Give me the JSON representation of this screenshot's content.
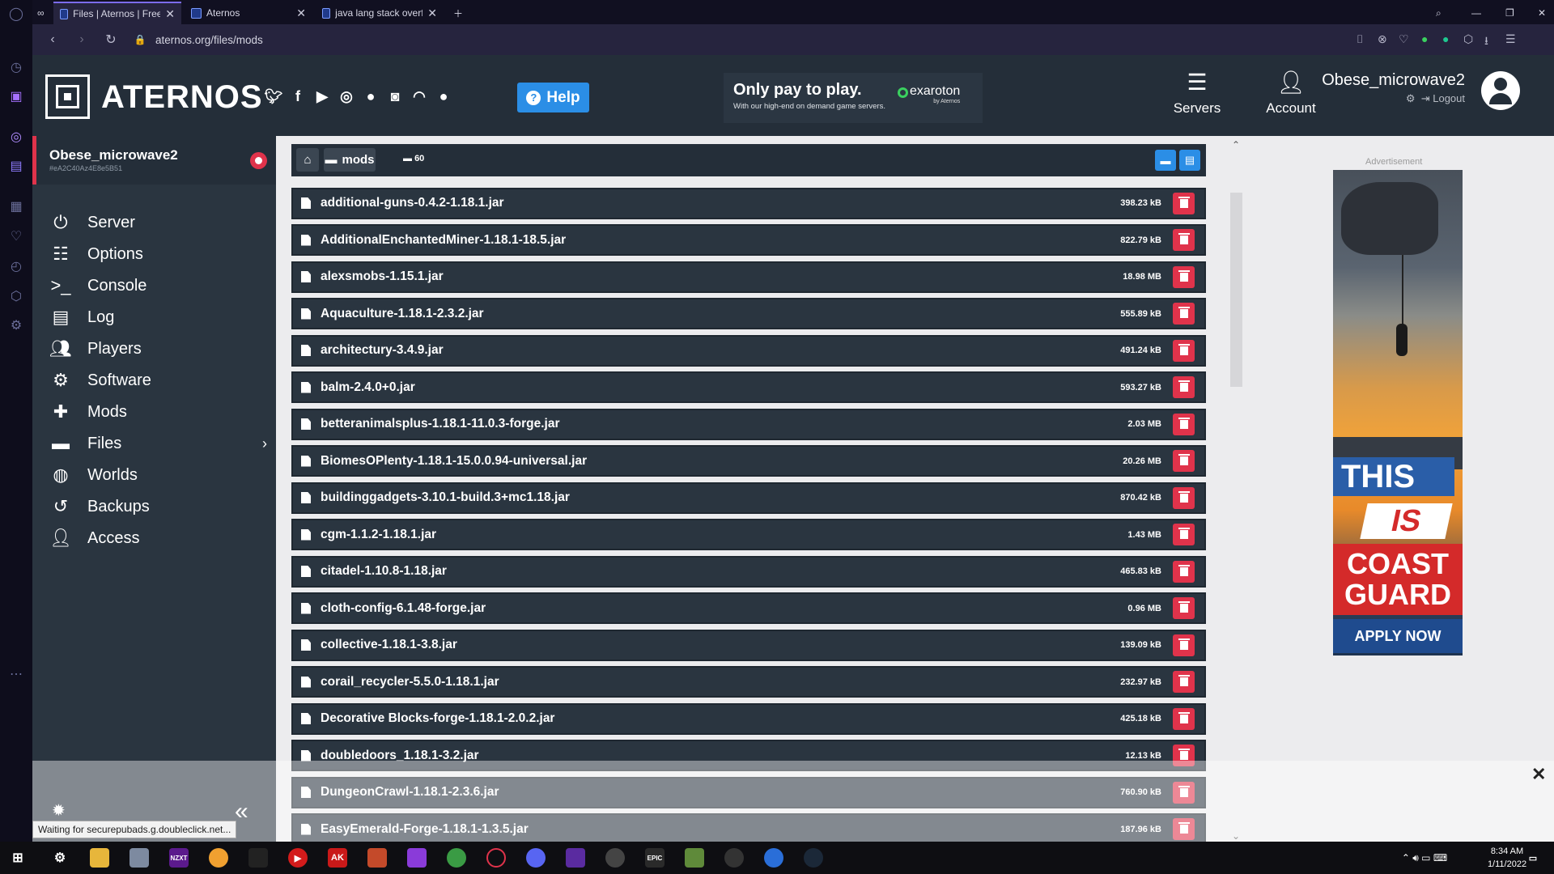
{
  "browser": {
    "tabs": [
      {
        "title": "Files | Aternos | Free Minec",
        "active": true
      },
      {
        "title": "Aternos",
        "active": false
      },
      {
        "title": "java lang stack overflow err",
        "active": false
      }
    ],
    "url": "aternos.org/files/mods",
    "status_text": "Waiting for securepubads.g.doubleclick.net..."
  },
  "header": {
    "logo": "ATERNOS",
    "help_label": "Help",
    "ad": {
      "headline": "Only pay to play.",
      "subline": "With our high-end on demand game servers.",
      "brand": "exaroton",
      "brand_sub": "by Aternos"
    },
    "nav": [
      {
        "label": "Servers",
        "icon": "servers-icon"
      },
      {
        "label": "Account",
        "icon": "account-icon"
      }
    ],
    "user": {
      "name": "Obese_microwave2",
      "logout": "Logout"
    }
  },
  "server": {
    "name": "Obese_microwave2",
    "id": "#eA2C40Az4E8e5B51"
  },
  "sidebar": {
    "items": [
      {
        "label": "Server",
        "icon": "power-icon"
      },
      {
        "label": "Options",
        "icon": "sliders-icon"
      },
      {
        "label": "Console",
        "icon": "terminal-icon"
      },
      {
        "label": "Log",
        "icon": "file-text-icon"
      },
      {
        "label": "Players",
        "icon": "users-icon"
      },
      {
        "label": "Software",
        "icon": "gears-icon"
      },
      {
        "label": "Mods",
        "icon": "puzzle-icon"
      },
      {
        "label": "Files",
        "icon": "folder-icon"
      },
      {
        "label": "Worlds",
        "icon": "globe-icon"
      },
      {
        "label": "Backups",
        "icon": "history-icon"
      },
      {
        "label": "Access",
        "icon": "user-lock-icon"
      }
    ]
  },
  "breadcrumb": {
    "folder": "mods",
    "count": "60"
  },
  "files": [
    {
      "name": "additional-guns-0.4.2-1.18.1.jar",
      "size": "398.23 kB"
    },
    {
      "name": "AdditionalEnchantedMiner-1.18.1-18.5.jar",
      "size": "822.79 kB"
    },
    {
      "name": "alexsmobs-1.15.1.jar",
      "size": "18.98 MB"
    },
    {
      "name": "Aquaculture-1.18.1-2.3.2.jar",
      "size": "555.89 kB"
    },
    {
      "name": "architectury-3.4.9.jar",
      "size": "491.24 kB"
    },
    {
      "name": "balm-2.4.0+0.jar",
      "size": "593.27 kB"
    },
    {
      "name": "betteranimalsplus-1.18.1-11.0.3-forge.jar",
      "size": "2.03 MB"
    },
    {
      "name": "BiomesOPlenty-1.18.1-15.0.0.94-universal.jar",
      "size": "20.26 MB"
    },
    {
      "name": "buildinggadgets-3.10.1-build.3+mc1.18.jar",
      "size": "870.42 kB"
    },
    {
      "name": "cgm-1.1.2-1.18.1.jar",
      "size": "1.43 MB"
    },
    {
      "name": "citadel-1.10.8-1.18.jar",
      "size": "465.83 kB"
    },
    {
      "name": "cloth-config-6.1.48-forge.jar",
      "size": "0.96 MB"
    },
    {
      "name": "collective-1.18.1-3.8.jar",
      "size": "139.09 kB"
    },
    {
      "name": "corail_recycler-5.5.0-1.18.1.jar",
      "size": "232.97 kB"
    },
    {
      "name": "Decorative Blocks-forge-1.18.1-2.0.2.jar",
      "size": "425.18 kB"
    },
    {
      "name": "doubledoors_1.18.1-3.2.jar",
      "size": "12.13 kB"
    },
    {
      "name": "DungeonCrawl-1.18.1-2.3.6.jar",
      "size": "760.90 kB"
    },
    {
      "name": "EasyEmerald-Forge-1.18.1-1.3.5.jar",
      "size": "187.96 kB"
    }
  ],
  "sidebar_ad": {
    "label": "Advertisement",
    "line1": "THIS",
    "line2": "IS",
    "line3": "COAST GUARD",
    "cta": "APPLY NOW"
  },
  "clock": {
    "time": "8:34 AM",
    "date": "1/11/2022"
  },
  "colors": {
    "brand_red": "#e0334b",
    "brand_blue": "#2b8ee6",
    "header_bg": "#242e39",
    "sidebar_bg": "#2a3540"
  }
}
